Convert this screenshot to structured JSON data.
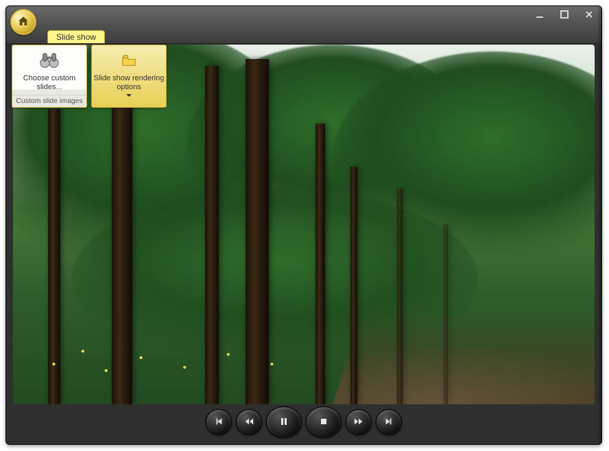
{
  "app": {
    "icon": "house-icon"
  },
  "tabs": {
    "active": "Slide show"
  },
  "ribbon": {
    "choose": {
      "label": "Choose custom slides...",
      "footer": "Custom slide images",
      "icon": "binoculars-icon"
    },
    "render": {
      "label": "Slide show rendering options",
      "icon": "folder-options-icon"
    }
  },
  "controls": {
    "first": "skip-previous-icon",
    "rewind": "rewind-icon",
    "pause": "pause-icon",
    "stop": "stop-icon",
    "forward": "fast-forward-icon",
    "last": "skip-next-icon"
  },
  "window_controls": {
    "minimize": "minimize-icon",
    "maximize": "maximize-icon",
    "close": "close-icon"
  }
}
